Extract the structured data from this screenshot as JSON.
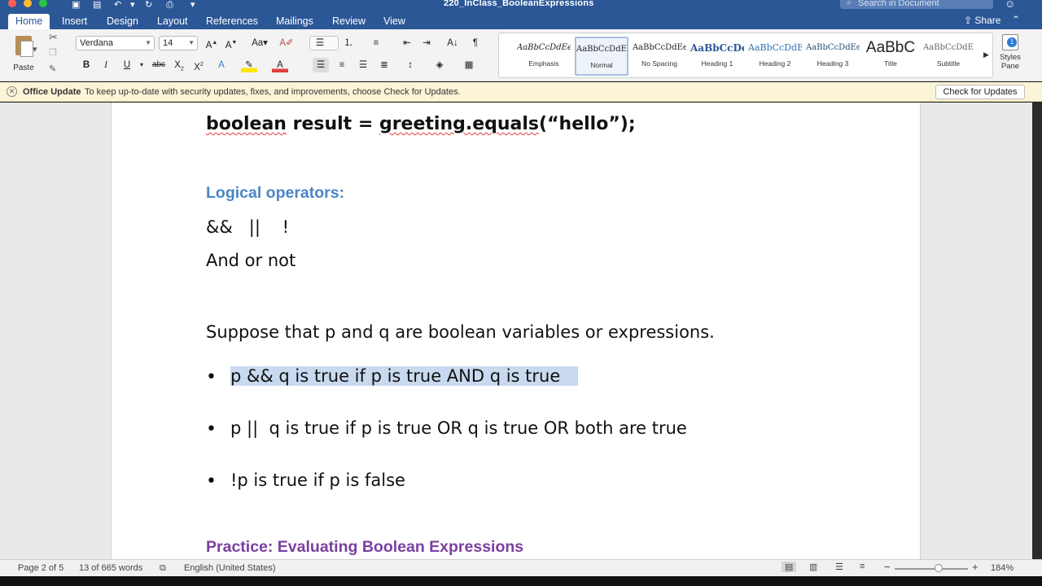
{
  "window": {
    "title": "220_InClass_BooleanExpressions",
    "search_placeholder": "Search in Document"
  },
  "tabs": [
    {
      "label": "Home",
      "active": true
    },
    {
      "label": "Insert"
    },
    {
      "label": "Design"
    },
    {
      "label": "Layout"
    },
    {
      "label": "References"
    },
    {
      "label": "Mailings"
    },
    {
      "label": "Review"
    },
    {
      "label": "View"
    }
  ],
  "share_label": "Share",
  "ribbon": {
    "paste_label": "Paste",
    "font_name": "Verdana",
    "font_size": "14",
    "styles": [
      {
        "sample": "AaBbCcDdEe",
        "name": "Emphasis"
      },
      {
        "sample": "AaBbCcDdEe",
        "name": "Normal",
        "selected": true
      },
      {
        "sample": "AaBbCcDdEe",
        "name": "No Spacing"
      },
      {
        "sample": "AaBbCcDe",
        "name": "Heading 1"
      },
      {
        "sample": "AaBbCcDdE",
        "name": "Heading 2"
      },
      {
        "sample": "AaBbCcDdEe",
        "name": "Heading 3"
      },
      {
        "sample": "AaBbC",
        "name": "Title"
      },
      {
        "sample": "AaBbCcDdE",
        "name": "Subtitle"
      }
    ],
    "styles_pane_label": "Styles Pane"
  },
  "update_bar": {
    "title": "Office Update",
    "message": "To keep up-to-date with security updates, fixes, and improvements, choose Check for Updates.",
    "button": "Check for Updates"
  },
  "document": {
    "code_line": {
      "part1": "boolean",
      "part2": " result = ",
      "part3": "greeting.equals",
      "part4": "(“hello”);"
    },
    "logical_heading": "Logical operators:",
    "operators_line": "&&   ||    !",
    "operators_words": "And or not",
    "suppose_line": "Suppose that p and q are boolean variables or expressions.",
    "bullets": [
      "p && q is true if p is true AND q is true",
      "p ||  q is true if p is true OR q is true OR both are true",
      "!p is true if p is false"
    ],
    "practice_heading": "Practice: Evaluating Boolean Expressions",
    "colors": {
      "logical_heading": "#4a86c5",
      "practice_heading": "#7b3fa0"
    }
  },
  "statusbar": {
    "page": "Page 2 of 5",
    "words": "13 of 665 words",
    "language": "English (United States)",
    "zoom": "184%",
    "zoom_level": 0.6
  }
}
